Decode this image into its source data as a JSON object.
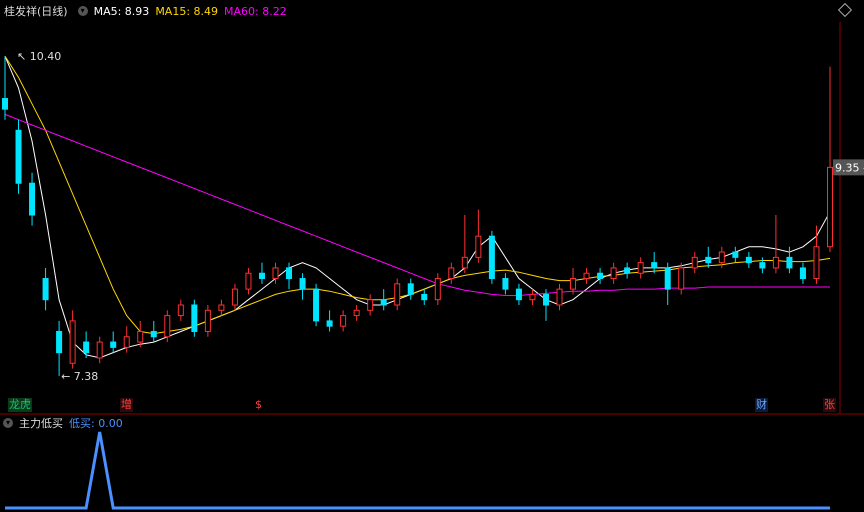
{
  "header": {
    "stock_name": "桂发祥(日线)",
    "indicators": [
      {
        "label": "MA5: 8.93",
        "color": "#ffffff"
      },
      {
        "label": "MA15: 8.49",
        "color": "#ffd700"
      },
      {
        "label": "MA60: 8.22",
        "color": "#ff00ff"
      }
    ]
  },
  "sub_header": {
    "title": "主力低买",
    "value_label": "低买: 0.00",
    "value_color": "#4a90ff"
  },
  "annotations": {
    "high_label": "10.40",
    "low_label": "7.38",
    "current_price": "9.35 -"
  },
  "badges": [
    {
      "text": "龙虎",
      "color": "#19c16d",
      "bg": "#0a3a1a"
    },
    {
      "text": "增",
      "color": "#ff4040",
      "bg": "#2a0a0a"
    },
    {
      "text": "$",
      "color": "#ff4040",
      "bg": "#000000"
    },
    {
      "text": "财",
      "color": "#6fa8ff",
      "bg": "#0a1a3a"
    },
    {
      "text": "张",
      "color": "#ff4040",
      "bg": "#2a0a0a"
    }
  ],
  "colors": {
    "up": "#ff3030",
    "down": "#00e5ff",
    "ma5": "#ffffff",
    "ma15": "#ffd700",
    "ma60": "#ff00ff",
    "indicator": "#4a90ff",
    "axis": "#8b0000"
  },
  "chart_data": [
    {
      "type": "candlestick",
      "title": "桂发祥(日线)",
      "ylim": [
        7.2,
        10.6
      ],
      "series": [
        {
          "name": "MA5",
          "values": [
            10.4,
            10.1,
            9.6,
            8.9,
            8.1,
            7.7,
            7.58,
            7.55,
            7.6,
            7.65,
            7.68,
            7.7,
            7.75,
            7.8,
            7.85,
            7.9,
            7.95,
            8.0,
            8.1,
            8.2,
            8.3,
            8.4,
            8.45,
            8.4,
            8.3,
            8.2,
            8.1,
            8.05,
            8.05,
            8.1,
            8.15,
            8.2,
            8.25,
            8.3,
            8.4,
            8.6,
            8.7,
            8.5,
            8.3,
            8.2,
            8.1,
            8.05,
            8.1,
            8.2,
            8.3,
            8.35,
            8.38,
            8.4,
            8.4,
            8.4,
            8.42,
            8.45,
            8.48,
            8.5,
            8.55,
            8.6,
            8.6,
            8.58,
            8.55,
            8.6,
            8.7,
            8.93
          ]
        },
        {
          "name": "MA15",
          "values": [
            10.4,
            10.2,
            9.95,
            9.7,
            9.4,
            9.1,
            8.8,
            8.5,
            8.2,
            7.95,
            7.8,
            7.78,
            7.8,
            7.82,
            7.85,
            7.9,
            7.95,
            8.0,
            8.05,
            8.1,
            8.15,
            8.18,
            8.2,
            8.2,
            8.18,
            8.15,
            8.12,
            8.1,
            8.1,
            8.12,
            8.15,
            8.2,
            8.25,
            8.3,
            8.33,
            8.35,
            8.37,
            8.38,
            8.36,
            8.33,
            8.3,
            8.28,
            8.28,
            8.3,
            8.32,
            8.33,
            8.35,
            8.36,
            8.37,
            8.38,
            8.4,
            8.41,
            8.42,
            8.43,
            8.45,
            8.46,
            8.47,
            8.47,
            8.46,
            8.46,
            8.47,
            8.49
          ]
        },
        {
          "name": "MA60",
          "values": [
            9.85,
            9.8,
            9.75,
            9.7,
            9.65,
            9.6,
            9.55,
            9.5,
            9.45,
            9.4,
            9.35,
            9.3,
            9.25,
            9.2,
            9.15,
            9.1,
            9.05,
            9.0,
            8.95,
            8.9,
            8.85,
            8.8,
            8.75,
            8.7,
            8.65,
            8.6,
            8.55,
            8.5,
            8.45,
            8.4,
            8.35,
            8.3,
            8.25,
            8.22,
            8.19,
            8.17,
            8.15,
            8.14,
            8.14,
            8.15,
            8.16,
            8.17,
            8.18,
            8.18,
            8.19,
            8.19,
            8.2,
            8.2,
            8.2,
            8.21,
            8.21,
            8.21,
            8.22,
            8.22,
            8.22,
            8.22,
            8.22,
            8.22,
            8.22,
            8.22,
            8.22,
            8.22
          ]
        }
      ],
      "candles": [
        [
          10.0,
          9.9,
          10.4,
          9.8
        ],
        [
          9.7,
          9.2,
          9.8,
          9.1
        ],
        [
          9.2,
          8.9,
          9.3,
          8.8
        ],
        [
          8.3,
          8.1,
          8.4,
          8.0
        ],
        [
          7.8,
          7.6,
          7.9,
          7.38
        ],
        [
          7.5,
          7.9,
          8.0,
          7.45
        ],
        [
          7.7,
          7.6,
          7.8,
          7.55
        ],
        [
          7.55,
          7.7,
          7.75,
          7.5
        ],
        [
          7.7,
          7.65,
          7.8,
          7.6
        ],
        [
          7.65,
          7.75,
          7.85,
          7.6
        ],
        [
          7.7,
          7.8,
          7.9,
          7.65
        ],
        [
          7.8,
          7.75,
          7.9,
          7.7
        ],
        [
          7.75,
          7.95,
          8.0,
          7.7
        ],
        [
          7.95,
          8.05,
          8.1,
          7.9
        ],
        [
          8.05,
          7.8,
          8.1,
          7.75
        ],
        [
          7.8,
          8.0,
          8.05,
          7.75
        ],
        [
          8.0,
          8.05,
          8.1,
          7.95
        ],
        [
          8.05,
          8.2,
          8.25,
          8.0
        ],
        [
          8.2,
          8.35,
          8.4,
          8.15
        ],
        [
          8.35,
          8.3,
          8.45,
          8.25
        ],
        [
          8.3,
          8.4,
          8.45,
          8.25
        ],
        [
          8.4,
          8.3,
          8.45,
          8.2
        ],
        [
          8.3,
          8.2,
          8.35,
          8.1
        ],
        [
          8.2,
          7.9,
          8.25,
          7.85
        ],
        [
          7.9,
          7.85,
          8.0,
          7.8
        ],
        [
          7.85,
          7.95,
          8.0,
          7.8
        ],
        [
          7.95,
          8.0,
          8.05,
          7.9
        ],
        [
          8.0,
          8.1,
          8.15,
          7.95
        ],
        [
          8.1,
          8.05,
          8.2,
          8.0
        ],
        [
          8.05,
          8.25,
          8.3,
          8.0
        ],
        [
          8.25,
          8.15,
          8.3,
          8.1
        ],
        [
          8.15,
          8.1,
          8.2,
          8.05
        ],
        [
          8.1,
          8.3,
          8.35,
          8.05
        ],
        [
          8.3,
          8.4,
          8.45,
          8.25
        ],
        [
          8.4,
          8.5,
          8.9,
          8.35
        ],
        [
          8.5,
          8.7,
          8.95,
          8.45
        ],
        [
          8.7,
          8.3,
          8.75,
          8.25
        ],
        [
          8.3,
          8.2,
          8.35,
          8.15
        ],
        [
          8.2,
          8.1,
          8.25,
          8.05
        ],
        [
          8.1,
          8.15,
          8.2,
          8.05
        ],
        [
          8.15,
          8.05,
          8.2,
          7.9
        ],
        [
          8.05,
          8.2,
          8.25,
          8.0
        ],
        [
          8.2,
          8.3,
          8.4,
          8.15
        ],
        [
          8.3,
          8.35,
          8.4,
          8.25
        ],
        [
          8.35,
          8.3,
          8.4,
          8.25
        ],
        [
          8.3,
          8.4,
          8.45,
          8.25
        ],
        [
          8.4,
          8.35,
          8.45,
          8.3
        ],
        [
          8.35,
          8.45,
          8.5,
          8.3
        ],
        [
          8.45,
          8.4,
          8.55,
          8.35
        ],
        [
          8.4,
          8.2,
          8.45,
          8.05
        ],
        [
          8.2,
          8.4,
          8.45,
          8.15
        ],
        [
          8.4,
          8.5,
          8.55,
          8.35
        ],
        [
          8.5,
          8.45,
          8.6,
          8.4
        ],
        [
          8.45,
          8.55,
          8.6,
          8.4
        ],
        [
          8.55,
          8.5,
          8.6,
          8.45
        ],
        [
          8.5,
          8.45,
          8.55,
          8.4
        ],
        [
          8.45,
          8.4,
          8.5,
          8.35
        ],
        [
          8.4,
          8.5,
          8.9,
          8.35
        ],
        [
          8.5,
          8.4,
          8.6,
          8.35
        ],
        [
          8.4,
          8.3,
          8.45,
          8.25
        ],
        [
          8.3,
          8.6,
          8.8,
          8.25
        ],
        [
          8.6,
          9.35,
          10.3,
          8.55
        ]
      ],
      "candle_fields": [
        "open",
        "close",
        "high",
        "low"
      ],
      "annotations": [
        "10.40",
        "7.38",
        "9.35"
      ]
    },
    {
      "type": "line",
      "title": "主力低买",
      "series": [
        {
          "name": "低买",
          "values": [
            0,
            0,
            0,
            0,
            0,
            0,
            0,
            1,
            0,
            0,
            0,
            0,
            0,
            0,
            0,
            0,
            0,
            0,
            0,
            0,
            0,
            0,
            0,
            0,
            0,
            0,
            0,
            0,
            0,
            0,
            0,
            0,
            0,
            0,
            0,
            0,
            0,
            0,
            0,
            0,
            0,
            0,
            0,
            0,
            0,
            0,
            0,
            0,
            0,
            0,
            0,
            0,
            0,
            0,
            0,
            0,
            0,
            0,
            0,
            0,
            0,
            0
          ]
        }
      ],
      "ylim": [
        0,
        1
      ]
    }
  ]
}
